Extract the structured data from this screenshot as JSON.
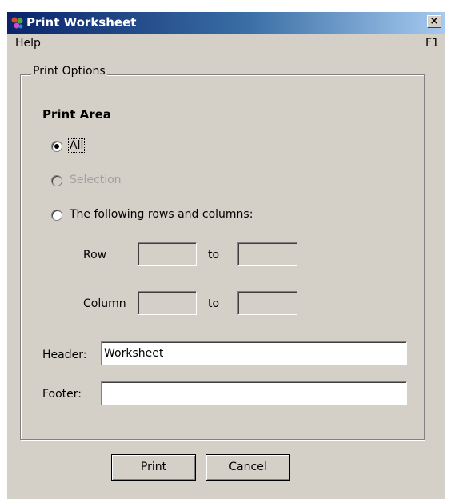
{
  "window": {
    "title": "Print Worksheet",
    "close_glyph": "×"
  },
  "menu": {
    "help": "Help",
    "shortcut": "F1"
  },
  "print_options": {
    "group_label": "Print Options",
    "print_area_heading": "Print Area",
    "options": [
      {
        "label": "All",
        "selected": true,
        "enabled": true
      },
      {
        "label": "Selection",
        "selected": false,
        "enabled": false
      },
      {
        "label": "The following rows and columns:",
        "selected": false,
        "enabled": true
      }
    ],
    "row_label": "Row",
    "column_label": "Column",
    "to_label": "to",
    "row_from": "",
    "row_to": "",
    "col_from": "",
    "col_to": ""
  },
  "header": {
    "label": "Header:",
    "value": "Worksheet"
  },
  "footer": {
    "label": "Footer:",
    "value": ""
  },
  "buttons": {
    "print": "Print",
    "cancel": "Cancel"
  }
}
